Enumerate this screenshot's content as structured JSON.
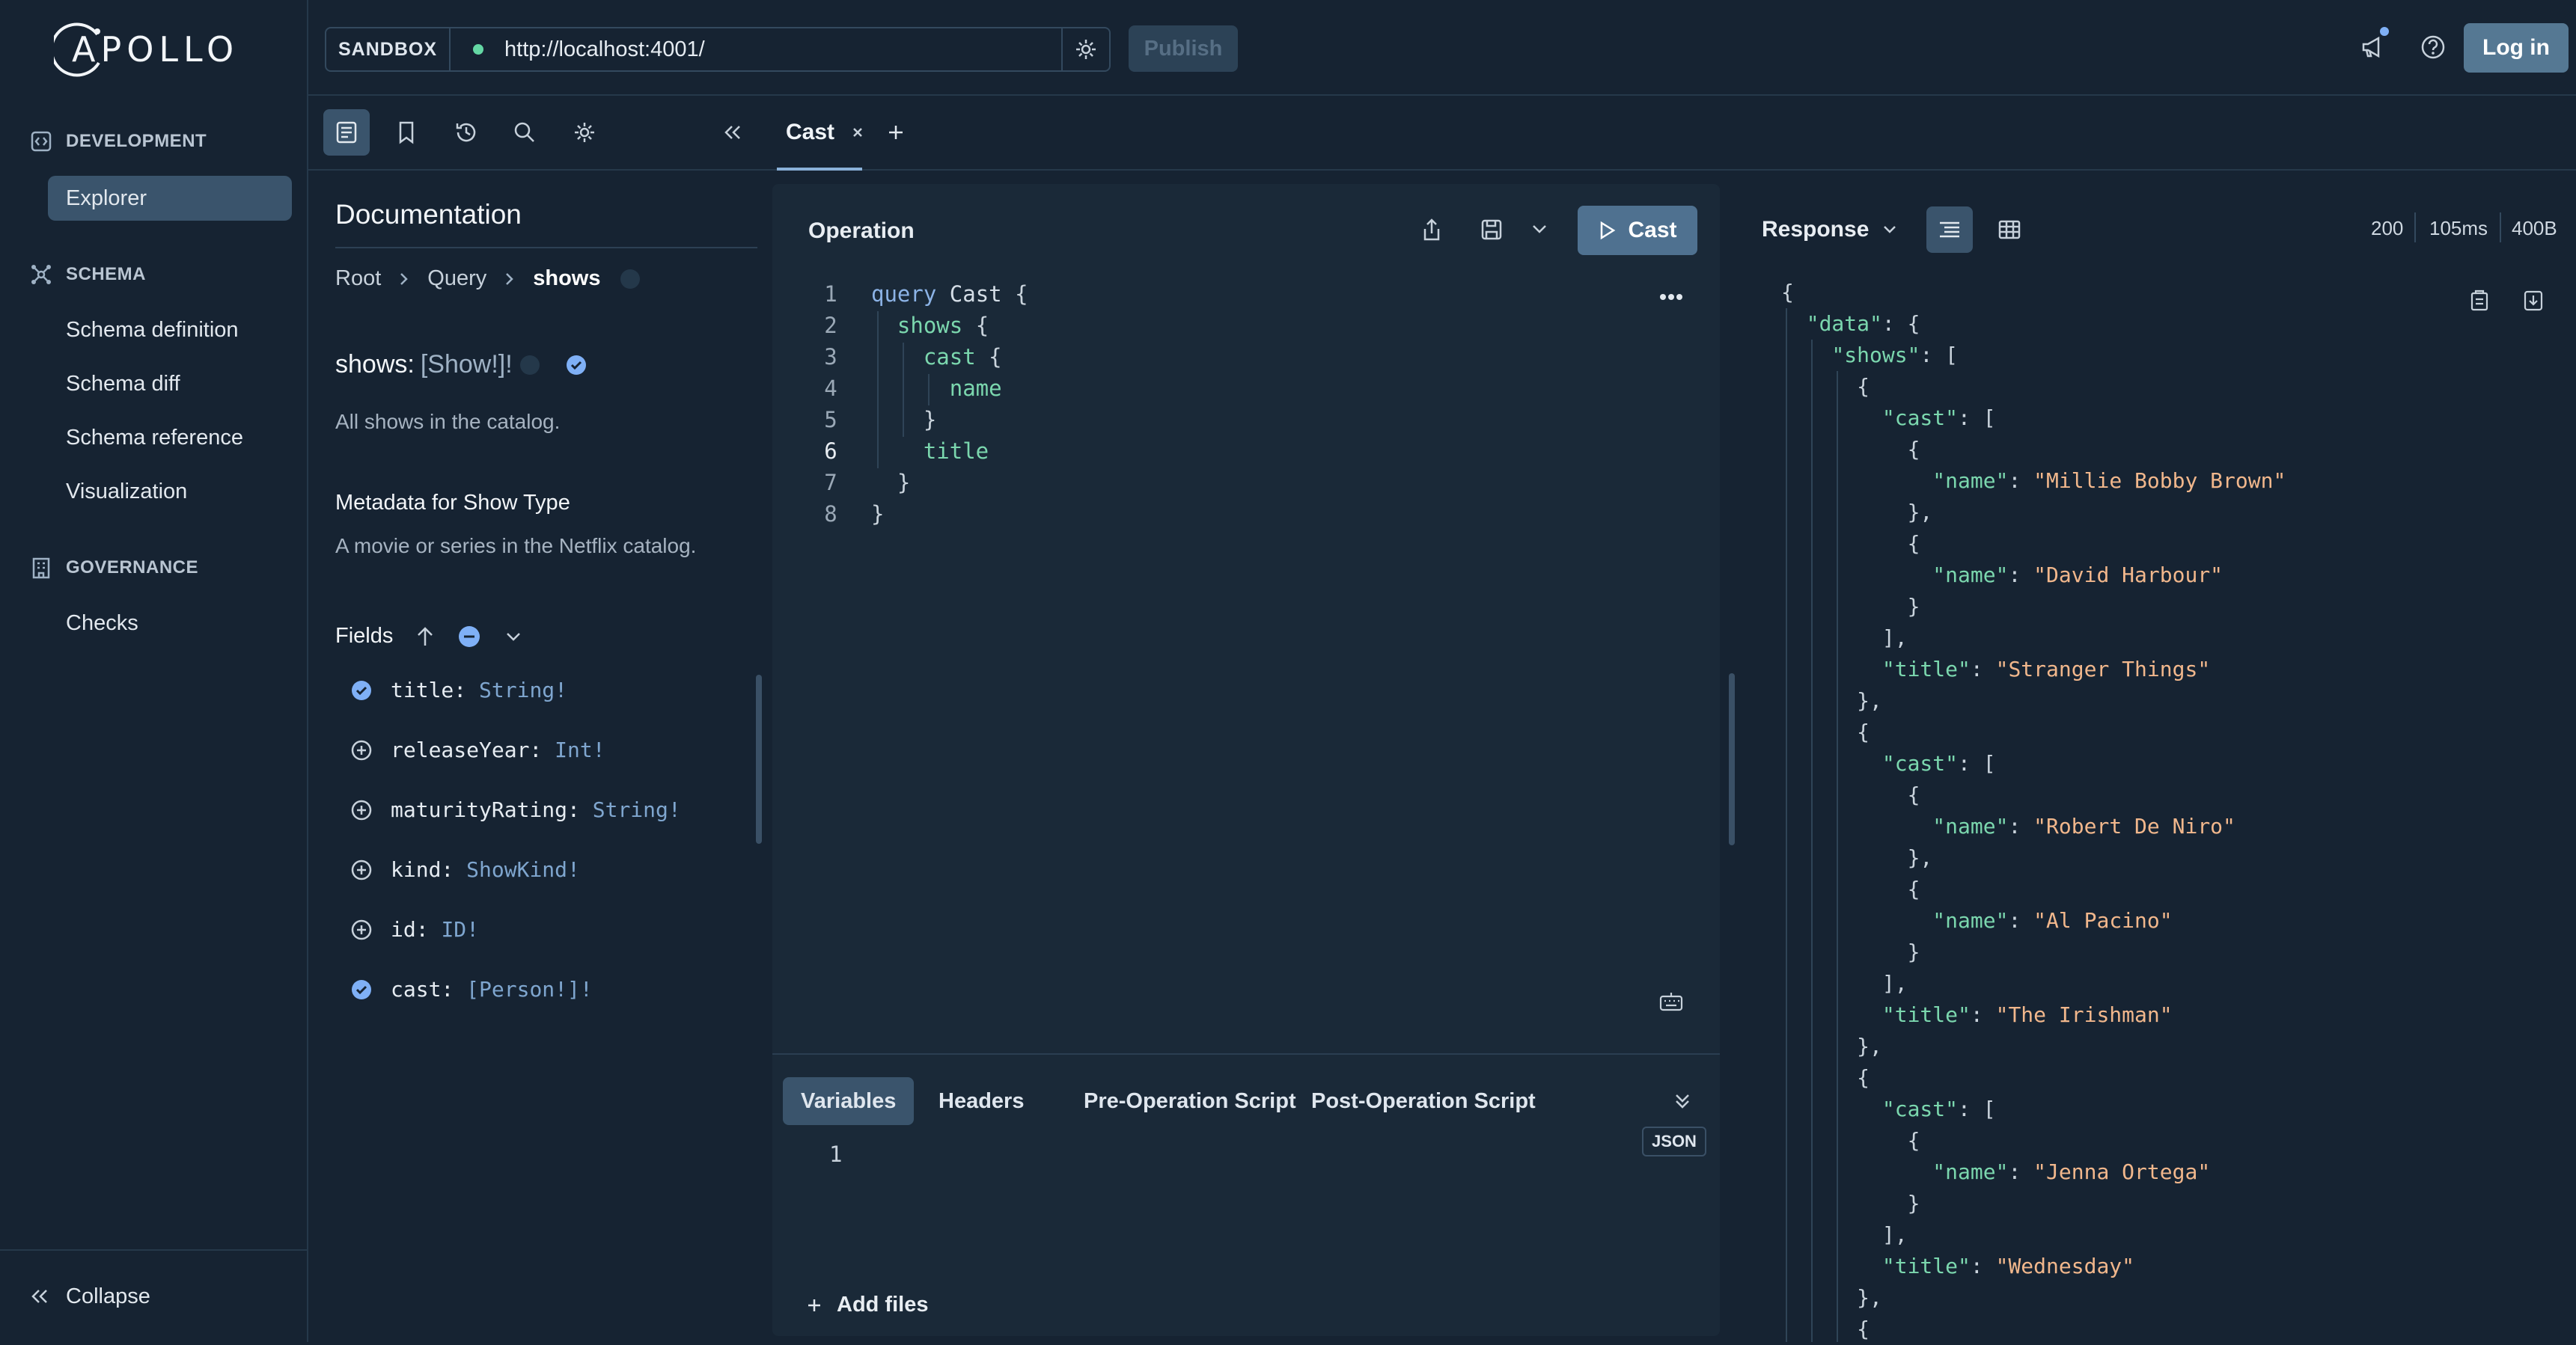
{
  "app": {
    "brand": "APOLLO",
    "sandbox_label": "SANDBOX",
    "endpoint_url": "http://localhost:4001/",
    "publish_label": "Publish",
    "login_label": "Log in"
  },
  "sidebar": {
    "development_label": "DEVELOPMENT",
    "schema_label": "SCHEMA",
    "governance_label": "GOVERNANCE",
    "items": [
      {
        "label": "Explorer",
        "active": true
      },
      {
        "label": "Schema definition"
      },
      {
        "label": "Schema diff"
      },
      {
        "label": "Schema reference"
      },
      {
        "label": "Visualization"
      },
      {
        "label": "Checks"
      }
    ],
    "collapse_label": "Collapse"
  },
  "tabs": [
    {
      "label": "Cast",
      "active": true
    }
  ],
  "docs": {
    "title": "Documentation",
    "breadcrumbs": [
      "Root",
      "Query",
      "shows"
    ],
    "field_name": "shows:",
    "field_type": "[Show!]!",
    "field_description": "All shows in the catalog.",
    "metadata_title": "Metadata for Show Type",
    "metadata_description": "A movie or series in the Netflix catalog.",
    "fields_label": "Fields",
    "fields": [
      {
        "name": "title:",
        "type": "String!",
        "selected": true
      },
      {
        "name": "releaseYear:",
        "type": "Int!",
        "selected": false
      },
      {
        "name": "maturityRating:",
        "type": "String!",
        "selected": false
      },
      {
        "name": "kind:",
        "type": "ShowKind!",
        "selected": false
      },
      {
        "name": "id:",
        "type": "ID!",
        "selected": false
      },
      {
        "name": "cast:",
        "type": "[Person!]!",
        "selected": true
      }
    ]
  },
  "operation": {
    "label": "Operation",
    "run_label": "Cast",
    "line_numbers": [
      "1",
      "2",
      "3",
      "4",
      "5",
      "6",
      "7",
      "8"
    ],
    "code": {
      "l1_kw": "query",
      "l1_name": "Cast",
      "l1_brace": "{",
      "l2_field": "shows",
      "l2_brace": "{",
      "l3_field": "cast",
      "l3_brace": "{",
      "l4_field": "name",
      "l5": "}",
      "l6_field": "title",
      "l7": "}",
      "l8": "}"
    }
  },
  "variables": {
    "tabs": [
      "Variables",
      "Headers",
      "Pre-Operation Script",
      "Post-Operation Script"
    ],
    "line_number": "1",
    "format_badge": "JSON",
    "add_files_label": "Add files"
  },
  "response": {
    "label": "Response",
    "status": "200",
    "time": "105ms",
    "size": "400B",
    "lines": [
      "{",
      "  \"data\": {",
      "    \"shows\": [",
      "      {",
      "        \"cast\": [",
      "          {",
      "            \"name\": \"Millie Bobby Brown\"",
      "          },",
      "          {",
      "            \"name\": \"David Harbour\"",
      "          }",
      "        ],",
      "        \"title\": \"Stranger Things\"",
      "      },",
      "      {",
      "        \"cast\": [",
      "          {",
      "            \"name\": \"Robert De Niro\"",
      "          },",
      "          {",
      "            \"name\": \"Al Pacino\"",
      "          }",
      "        ],",
      "        \"title\": \"The Irishman\"",
      "      },",
      "      {",
      "        \"cast\": [",
      "          {",
      "            \"name\": \"Jenna Ortega\"",
      "          }",
      "        ],",
      "        \"title\": \"Wednesday\"",
      "      },",
      "      {"
    ]
  },
  "colors": {
    "background": "#162332",
    "panel": "#1a2938",
    "accent": "#4f7190",
    "field_key": "#7bd7ae",
    "string_value": "#f1b78c",
    "type": "#7fa6cf"
  }
}
